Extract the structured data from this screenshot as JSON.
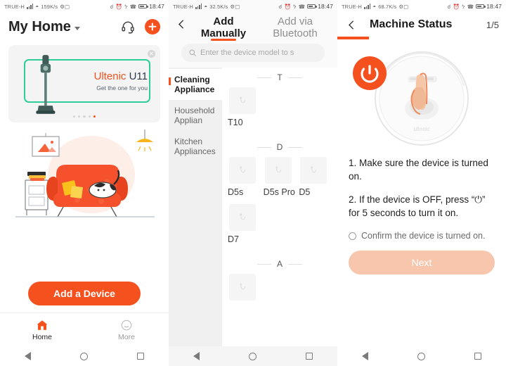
{
  "statusbar": {
    "carrier": "TRUE-H",
    "speed1": "159K/s",
    "speed2": "32.5K/s",
    "speed3": "68.7K/s",
    "time": "18:47",
    "wifi_icon": "wifi-icon",
    "signal_icon": "signal-bars-icon",
    "vpn_icon": "vpn-key-icon",
    "alarm_icon": "alarm-icon",
    "bluetooth_icon": "bluetooth-icon",
    "mute_icon": "silent-mode-icon",
    "battery_icon": "battery-icon"
  },
  "panel1": {
    "title": "My Home",
    "dropdown_icon": "chevron-down-icon",
    "support_icon": "headset-icon",
    "add_icon": "plus-icon",
    "banner": {
      "close_icon": "close-icon",
      "brand": "Ultenic",
      "model": " U11",
      "subtitle": "Get the one for you",
      "product_icon": "stick-vacuum-icon",
      "dots": 5,
      "active_dot": 5
    },
    "illustration": "living-room-illustration",
    "add_device_label": "Add a Device",
    "tabs": [
      {
        "label": "Home",
        "icon": "home-icon",
        "active": true
      },
      {
        "label": "More",
        "icon": "smiley-face-icon",
        "active": false
      }
    ]
  },
  "panel2": {
    "back_icon": "back-chevron-icon",
    "tabs": [
      {
        "label": "Add Manually",
        "active": true
      },
      {
        "label": "Add via Bluetooth",
        "active": false
      }
    ],
    "search": {
      "icon": "search-icon",
      "placeholder": "Enter the device model to s"
    },
    "categories": [
      {
        "label": "Cleaning Appliance",
        "active": true
      },
      {
        "label": "Household Applian",
        "active": false
      },
      {
        "label": "Kitchen Appliances",
        "active": false
      }
    ],
    "groups": [
      {
        "letter": "T",
        "devices": [
          "T10"
        ]
      },
      {
        "letter": "D",
        "devices": [
          "D5s",
          "D5s Pro",
          "D5",
          "D7"
        ]
      },
      {
        "letter": "A",
        "devices": []
      }
    ],
    "device_thumb_icon": "robot-vacuum-icon"
  },
  "panel3": {
    "back_icon": "back-chevron-icon",
    "title": "Machine Status",
    "step": "1/5",
    "power_icon": "power-icon",
    "robot_image": "robot-vacuum-hand-press-illustration",
    "instruction_1": "1. Make sure the device is turned on.",
    "instruction_2": "2. If the device is OFF, press “⏻” for 5 seconds to turn it on.",
    "confirm_icon": "radio-unchecked-icon",
    "confirm_label": "Confirm the device is turned on.",
    "next_label": "Next"
  },
  "navbar": {
    "back_icon": "nav-back-icon",
    "home_icon": "nav-home-icon",
    "recents_icon": "nav-recents-icon"
  },
  "colors": {
    "accent": "#F4511E",
    "banner_green": "#2ecd9a",
    "next_disabled": "#f7c6ad"
  }
}
